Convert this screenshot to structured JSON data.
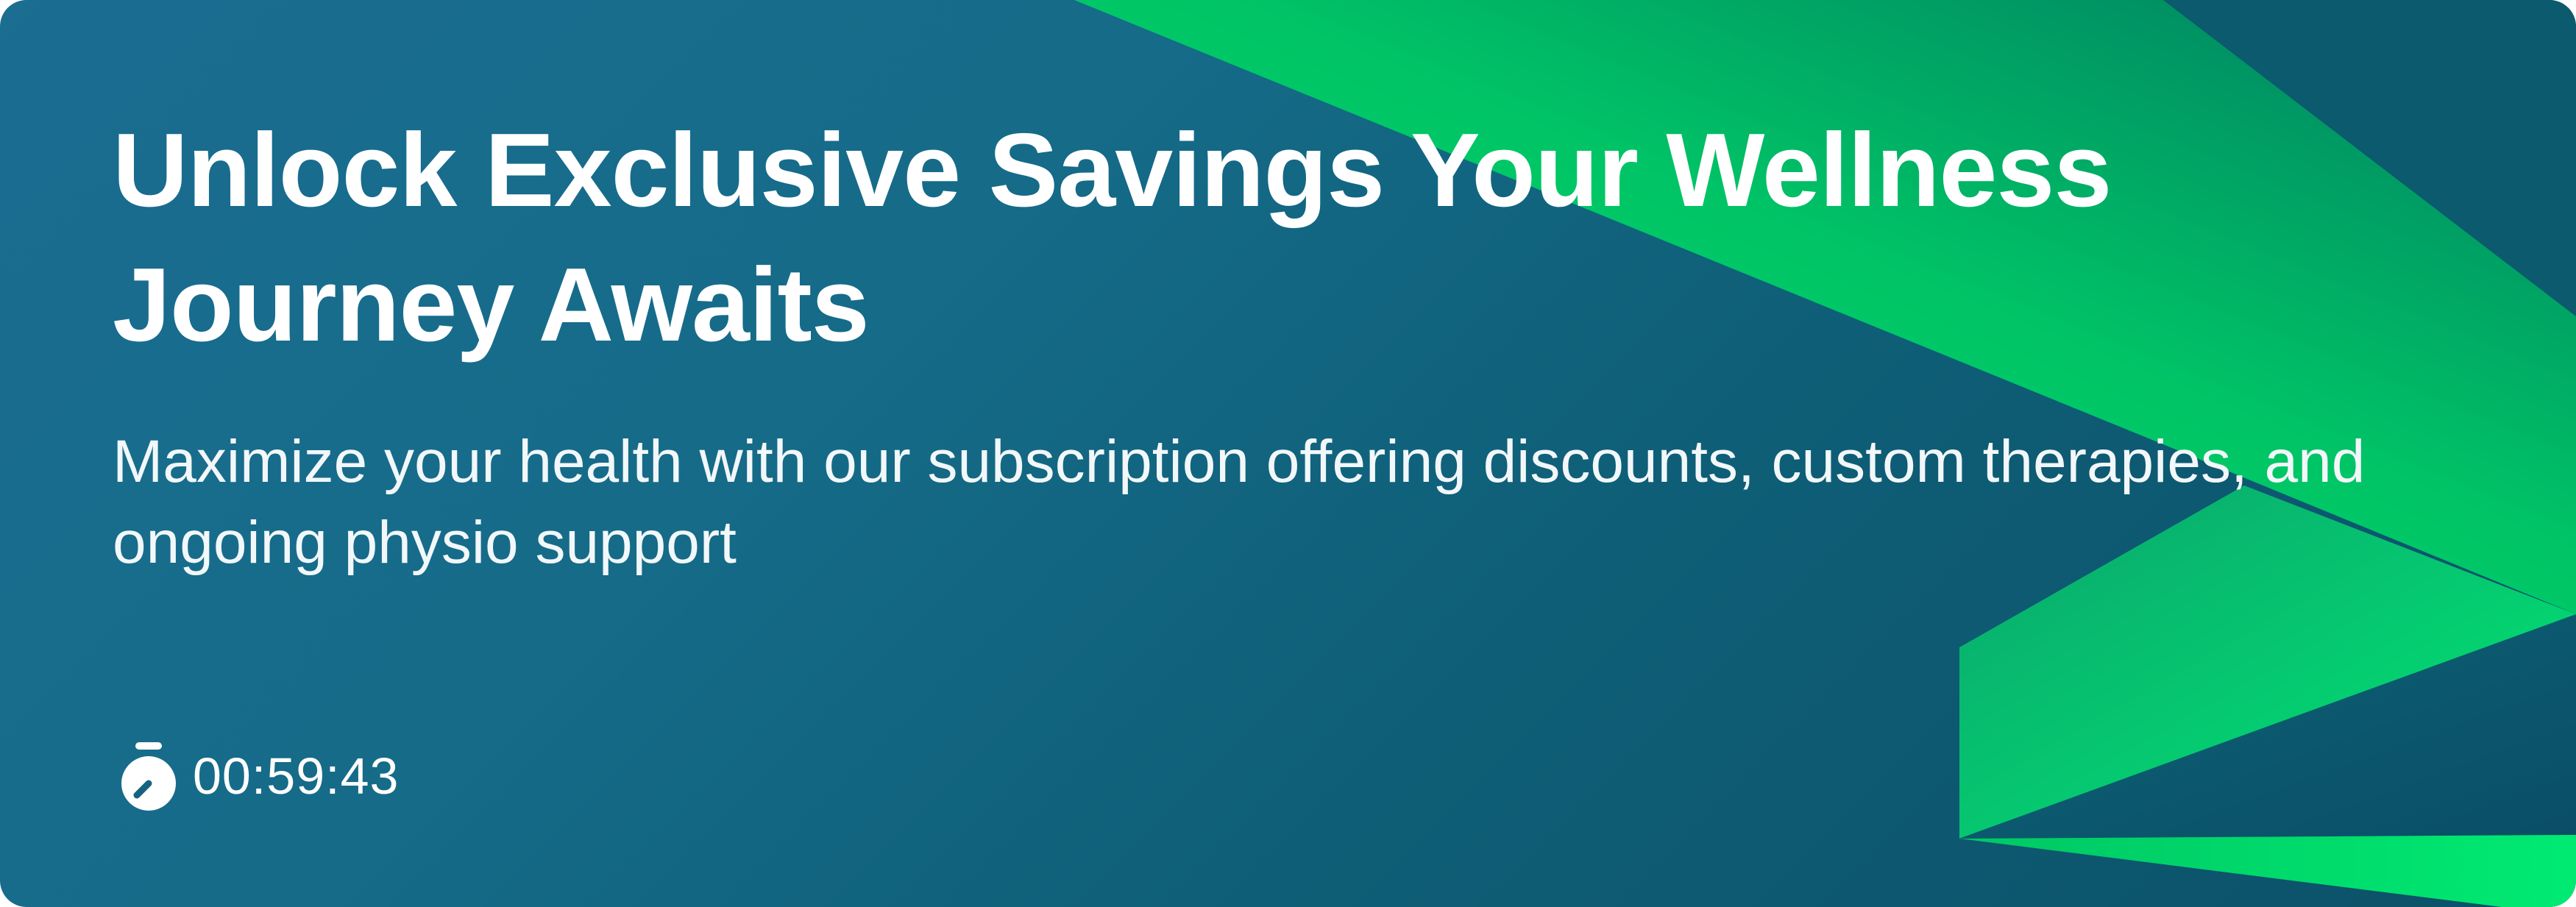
{
  "promo": {
    "title": "Unlock Exclusive Savings Your Wellness Journey Awaits",
    "description": "Maximize your health with our subscription offering discounts, custom therapies, and ongoing physio support",
    "countdown": "00:59:43",
    "timer_icon": "stopwatch-icon"
  },
  "colors": {
    "background_start": "#1b6d91",
    "background_end": "#0b5168",
    "accent_green": "#00d86c",
    "text": "#ffffff"
  }
}
